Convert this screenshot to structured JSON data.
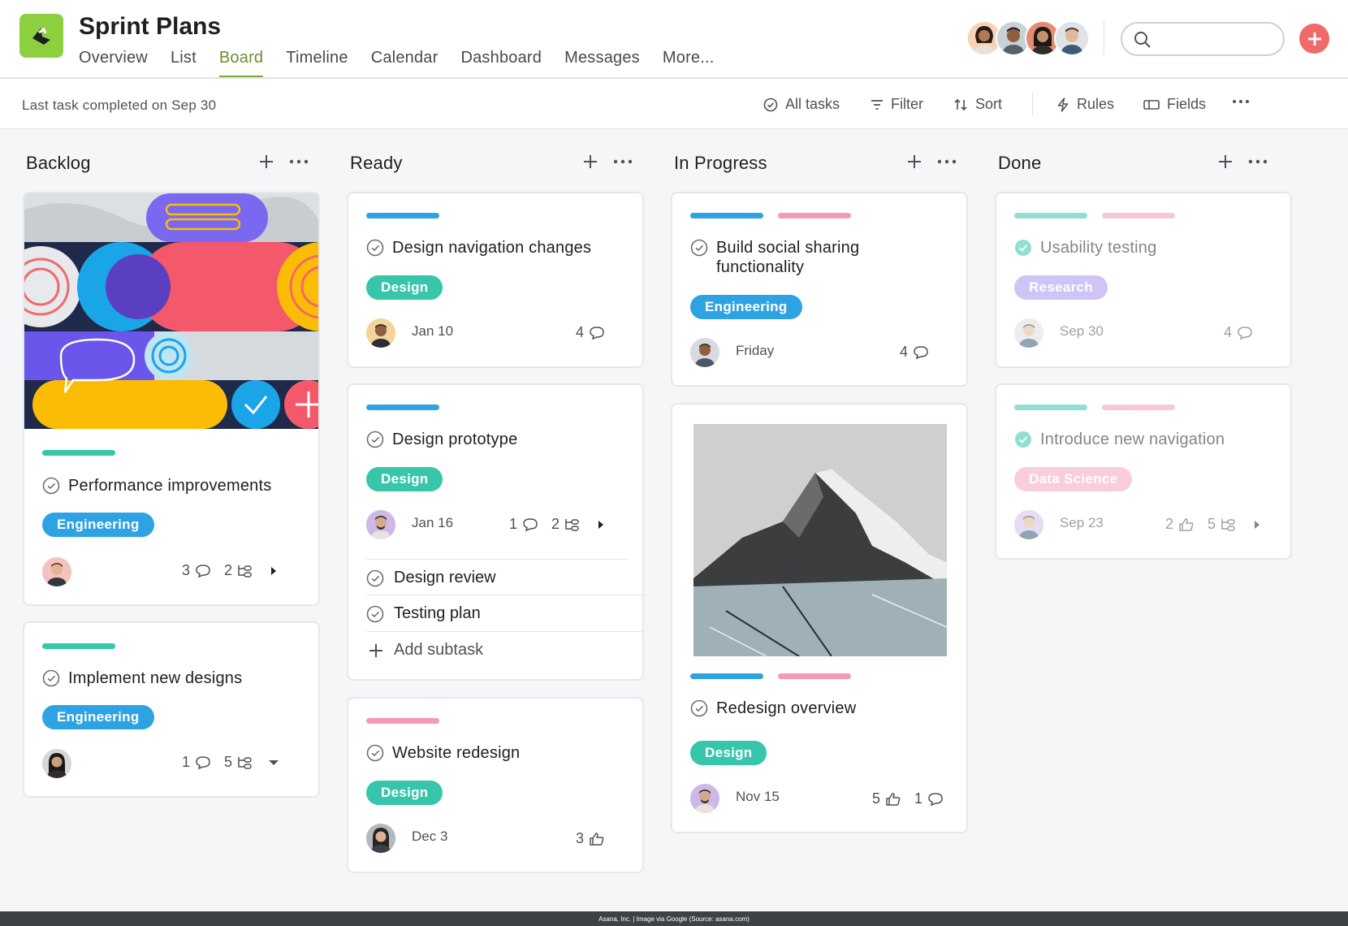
{
  "header": {
    "project_title": "Sprint Plans",
    "tabs": [
      {
        "label": "Overview",
        "active": false
      },
      {
        "label": "List",
        "active": false
      },
      {
        "label": "Board",
        "active": true
      },
      {
        "label": "Timeline",
        "active": false
      },
      {
        "label": "Calendar",
        "active": false
      },
      {
        "label": "Dashboard",
        "active": false
      },
      {
        "label": "Messages",
        "active": false
      },
      {
        "label": "More...",
        "active": false
      }
    ],
    "search": {
      "placeholder": ""
    },
    "accent_color": "#7aab2e",
    "add_button_color": "#f06a6a"
  },
  "toolbar": {
    "status": "Last task completed on Sep 30",
    "all_tasks": "All tasks",
    "filter": "Filter",
    "sort": "Sort",
    "rules": "Rules",
    "fields": "Fields"
  },
  "columns": [
    {
      "title": "Backlog"
    },
    {
      "title": "Ready"
    },
    {
      "title": "In Progress"
    },
    {
      "title": "Done"
    }
  ],
  "tag_colors": {
    "design": "#37c5ab",
    "engineering": "#2ea3e3",
    "research": "#a894f0",
    "data_science": "#f7a6be"
  },
  "cards": {
    "perf": {
      "title": "Performance improvements",
      "tag": "Engineering",
      "comments": "3",
      "subtasks": "2"
    },
    "implement": {
      "title": "Implement new designs",
      "tag": "Engineering",
      "comments": "1",
      "subtasks": "5"
    },
    "nav": {
      "title": "Design navigation changes",
      "tag": "Design",
      "date": "Jan 10",
      "comments": "4"
    },
    "proto": {
      "title": "Design prototype",
      "tag": "Design",
      "date": "Jan 16",
      "comments": "1",
      "subtasks": "2",
      "subtask_items": [
        "Design review",
        "Testing plan"
      ],
      "add_subtask": "Add subtask"
    },
    "website": {
      "title": "Website redesign",
      "tag": "Design",
      "date": "Dec 3",
      "likes": "3"
    },
    "social": {
      "title_line1": "Build social sharing",
      "title_line2": "functionality",
      "tag": "Engineering",
      "date": "Friday",
      "comments": "4"
    },
    "redesign": {
      "title": "Redesign overview",
      "tag": "Design",
      "date": "Nov 15",
      "likes": "5",
      "comments": "1"
    },
    "usability": {
      "title": "Usability testing",
      "tag": "Research",
      "date": "Sep 30",
      "comments": "4"
    },
    "intro": {
      "title": "Introduce new navigation",
      "tag": "Data Science",
      "date": "Sep 23",
      "likes": "2",
      "subtasks": "5"
    }
  },
  "footer": {
    "credit": "Asana, Inc. | Image via Google (Source: asana.com)"
  },
  "icons": [
    "logo-icon",
    "search-icon",
    "plus-icon",
    "check-circle-icon",
    "filter-icon",
    "sort-icon",
    "lightning-icon",
    "fields-icon",
    "more-icon",
    "comment-icon",
    "subtask-icon",
    "like-icon",
    "caret-right-icon",
    "caret-down-icon"
  ]
}
